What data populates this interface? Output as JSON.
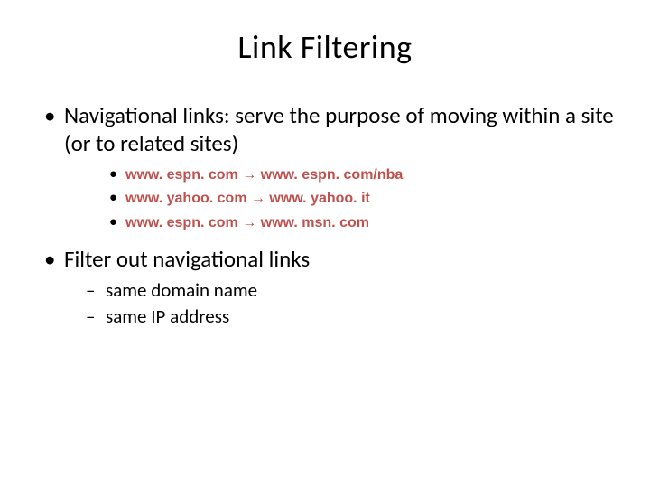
{
  "title": "Link Filtering",
  "bullets": {
    "b1": "Navigational links: serve the purpose of moving within a site (or to related sites)",
    "examples": {
      "e1": "www. espn. com → www. espn. com/nba",
      "e2": "www. yahoo. com → www. yahoo. it",
      "e3": "www. espn. com  → www. msn. com"
    },
    "b2": "Filter out navigational links",
    "sub": {
      "s1": "same domain name",
      "s2": "same IP address"
    }
  }
}
